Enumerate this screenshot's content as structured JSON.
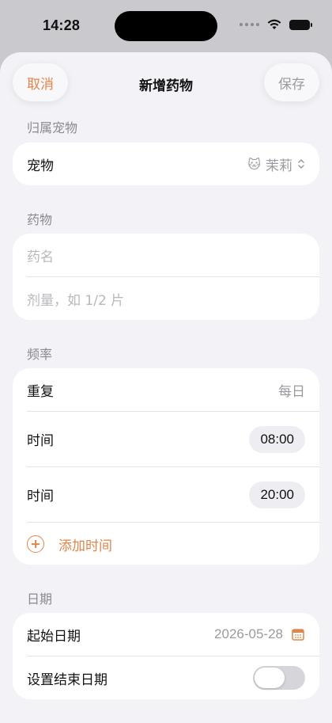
{
  "status_bar": {
    "time": "14:28"
  },
  "nav": {
    "cancel": "取消",
    "title": "新增药物",
    "save": "保存"
  },
  "pet_section": {
    "label": "归属宠物",
    "row_label": "宠物",
    "pet_emoji": "🐱",
    "pet_name": "茉莉"
  },
  "medicine_section": {
    "label": "药物",
    "name_placeholder": "药名",
    "dose_placeholder": "剂量，如 1/2 片"
  },
  "frequency_section": {
    "label": "频率",
    "repeat_label": "重复",
    "repeat_value": "每日",
    "times": [
      {
        "label": "时间",
        "value": "08:00"
      },
      {
        "label": "时间",
        "value": "20:00"
      }
    ],
    "add_time": "添加时间"
  },
  "date_section": {
    "label": "日期",
    "start_label": "起始日期",
    "start_value": "2026-05-28",
    "end_label": "设置结束日期",
    "end_enabled": false
  },
  "colors": {
    "accent": "#e0864a",
    "background": "#f2f2f7"
  }
}
